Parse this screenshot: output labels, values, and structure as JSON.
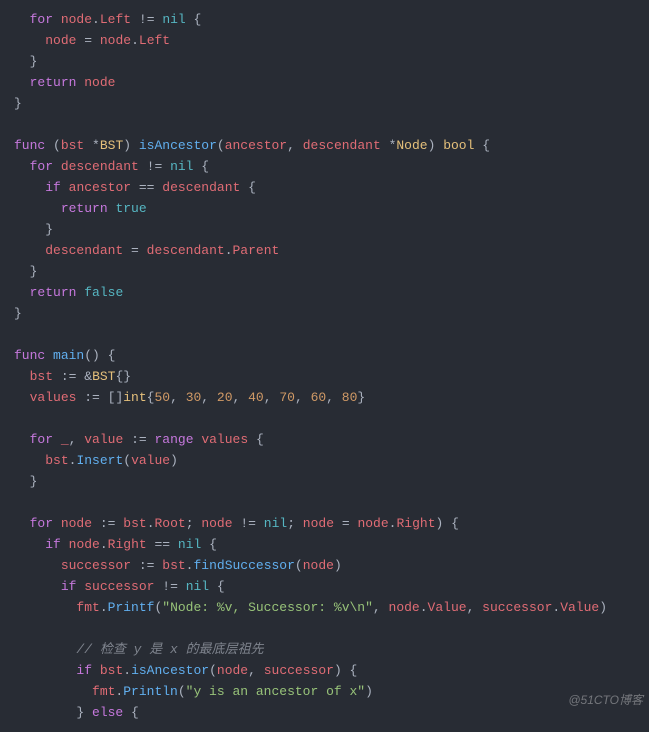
{
  "watermark": "@51CTO博客",
  "code": {
    "lines": [
      [
        [
          "pn",
          "  "
        ],
        [
          "kw",
          "for"
        ],
        [
          "pn",
          " "
        ],
        [
          "id",
          "node"
        ],
        [
          "pn",
          "."
        ],
        [
          "id",
          "Left"
        ],
        [
          "pn",
          " "
        ],
        [
          "op",
          "!="
        ],
        [
          "pn",
          " "
        ],
        [
          "lit",
          "nil"
        ],
        [
          "pn",
          " {"
        ]
      ],
      [
        [
          "pn",
          "    "
        ],
        [
          "id",
          "node"
        ],
        [
          "pn",
          " "
        ],
        [
          "op",
          "="
        ],
        [
          "pn",
          " "
        ],
        [
          "id",
          "node"
        ],
        [
          "pn",
          "."
        ],
        [
          "id",
          "Left"
        ]
      ],
      [
        [
          "pn",
          "  }"
        ]
      ],
      [
        [
          "pn",
          "  "
        ],
        [
          "kw",
          "return"
        ],
        [
          "pn",
          " "
        ],
        [
          "id",
          "node"
        ]
      ],
      [
        [
          "pn",
          "}"
        ]
      ],
      [
        [
          "pn",
          ""
        ]
      ],
      [
        [
          "kw",
          "func"
        ],
        [
          "pn",
          " ("
        ],
        [
          "id",
          "bst"
        ],
        [
          "pn",
          " "
        ],
        [
          "op",
          "*"
        ],
        [
          "typ",
          "BST"
        ],
        [
          "pn",
          ") "
        ],
        [
          "fn",
          "isAncestor"
        ],
        [
          "pn",
          "("
        ],
        [
          "id",
          "ancestor"
        ],
        [
          "pn",
          ", "
        ],
        [
          "id",
          "descendant"
        ],
        [
          "pn",
          " "
        ],
        [
          "op",
          "*"
        ],
        [
          "typ",
          "Node"
        ],
        [
          "pn",
          ") "
        ],
        [
          "typ",
          "bool"
        ],
        [
          "pn",
          " {"
        ]
      ],
      [
        [
          "pn",
          "  "
        ],
        [
          "kw",
          "for"
        ],
        [
          "pn",
          " "
        ],
        [
          "id",
          "descendant"
        ],
        [
          "pn",
          " "
        ],
        [
          "op",
          "!="
        ],
        [
          "pn",
          " "
        ],
        [
          "lit",
          "nil"
        ],
        [
          "pn",
          " {"
        ]
      ],
      [
        [
          "pn",
          "    "
        ],
        [
          "kw",
          "if"
        ],
        [
          "pn",
          " "
        ],
        [
          "id",
          "ancestor"
        ],
        [
          "pn",
          " "
        ],
        [
          "op",
          "=="
        ],
        [
          "pn",
          " "
        ],
        [
          "id",
          "descendant"
        ],
        [
          "pn",
          " {"
        ]
      ],
      [
        [
          "pn",
          "      "
        ],
        [
          "kw",
          "return"
        ],
        [
          "pn",
          " "
        ],
        [
          "lit",
          "true"
        ]
      ],
      [
        [
          "pn",
          "    }"
        ]
      ],
      [
        [
          "pn",
          "    "
        ],
        [
          "id",
          "descendant"
        ],
        [
          "pn",
          " "
        ],
        [
          "op",
          "="
        ],
        [
          "pn",
          " "
        ],
        [
          "id",
          "descendant"
        ],
        [
          "pn",
          "."
        ],
        [
          "id",
          "Parent"
        ]
      ],
      [
        [
          "pn",
          "  }"
        ]
      ],
      [
        [
          "pn",
          "  "
        ],
        [
          "kw",
          "return"
        ],
        [
          "pn",
          " "
        ],
        [
          "lit",
          "false"
        ]
      ],
      [
        [
          "pn",
          "}"
        ]
      ],
      [
        [
          "pn",
          ""
        ]
      ],
      [
        [
          "kw",
          "func"
        ],
        [
          "pn",
          " "
        ],
        [
          "fn",
          "main"
        ],
        [
          "pn",
          "() {"
        ]
      ],
      [
        [
          "pn",
          "  "
        ],
        [
          "id",
          "bst"
        ],
        [
          "pn",
          " "
        ],
        [
          "op",
          ":="
        ],
        [
          "pn",
          " "
        ],
        [
          "op",
          "&"
        ],
        [
          "typ",
          "BST"
        ],
        [
          "pn",
          "{}"
        ]
      ],
      [
        [
          "pn",
          "  "
        ],
        [
          "id",
          "values"
        ],
        [
          "pn",
          " "
        ],
        [
          "op",
          ":="
        ],
        [
          "pn",
          " []"
        ],
        [
          "typ",
          "int"
        ],
        [
          "pn",
          "{"
        ],
        [
          "num",
          "50"
        ],
        [
          "pn",
          ", "
        ],
        [
          "num",
          "30"
        ],
        [
          "pn",
          ", "
        ],
        [
          "num",
          "20"
        ],
        [
          "pn",
          ", "
        ],
        [
          "num",
          "40"
        ],
        [
          "pn",
          ", "
        ],
        [
          "num",
          "70"
        ],
        [
          "pn",
          ", "
        ],
        [
          "num",
          "60"
        ],
        [
          "pn",
          ", "
        ],
        [
          "num",
          "80"
        ],
        [
          "pn",
          "}"
        ]
      ],
      [
        [
          "pn",
          ""
        ]
      ],
      [
        [
          "pn",
          "  "
        ],
        [
          "kw",
          "for"
        ],
        [
          "pn",
          " "
        ],
        [
          "id",
          "_"
        ],
        [
          "pn",
          ", "
        ],
        [
          "id",
          "value"
        ],
        [
          "pn",
          " "
        ],
        [
          "op",
          ":="
        ],
        [
          "pn",
          " "
        ],
        [
          "kw",
          "range"
        ],
        [
          "pn",
          " "
        ],
        [
          "id",
          "values"
        ],
        [
          "pn",
          " {"
        ]
      ],
      [
        [
          "pn",
          "    "
        ],
        [
          "id",
          "bst"
        ],
        [
          "pn",
          "."
        ],
        [
          "fn",
          "Insert"
        ],
        [
          "pn",
          "("
        ],
        [
          "id",
          "value"
        ],
        [
          "pn",
          ")"
        ]
      ],
      [
        [
          "pn",
          "  }"
        ]
      ],
      [
        [
          "pn",
          ""
        ]
      ],
      [
        [
          "pn",
          "  "
        ],
        [
          "kw",
          "for"
        ],
        [
          "pn",
          " "
        ],
        [
          "id",
          "node"
        ],
        [
          "pn",
          " "
        ],
        [
          "op",
          ":="
        ],
        [
          "pn",
          " "
        ],
        [
          "id",
          "bst"
        ],
        [
          "pn",
          "."
        ],
        [
          "id",
          "Root"
        ],
        [
          "pn",
          "; "
        ],
        [
          "id",
          "node"
        ],
        [
          "pn",
          " "
        ],
        [
          "op",
          "!="
        ],
        [
          "pn",
          " "
        ],
        [
          "lit",
          "nil"
        ],
        [
          "pn",
          "; "
        ],
        [
          "id",
          "node"
        ],
        [
          "pn",
          " "
        ],
        [
          "op",
          "="
        ],
        [
          "pn",
          " "
        ],
        [
          "id",
          "node"
        ],
        [
          "pn",
          "."
        ],
        [
          "id",
          "Right"
        ],
        [
          "pn",
          ") {"
        ]
      ],
      [
        [
          "pn",
          "    "
        ],
        [
          "kw",
          "if"
        ],
        [
          "pn",
          " "
        ],
        [
          "id",
          "node"
        ],
        [
          "pn",
          "."
        ],
        [
          "id",
          "Right"
        ],
        [
          "pn",
          " "
        ],
        [
          "op",
          "=="
        ],
        [
          "pn",
          " "
        ],
        [
          "lit",
          "nil"
        ],
        [
          "pn",
          " {"
        ]
      ],
      [
        [
          "pn",
          "      "
        ],
        [
          "id",
          "successor"
        ],
        [
          "pn",
          " "
        ],
        [
          "op",
          ":="
        ],
        [
          "pn",
          " "
        ],
        [
          "id",
          "bst"
        ],
        [
          "pn",
          "."
        ],
        [
          "fn",
          "findSuccessor"
        ],
        [
          "pn",
          "("
        ],
        [
          "id",
          "node"
        ],
        [
          "pn",
          ")"
        ]
      ],
      [
        [
          "pn",
          "      "
        ],
        [
          "kw",
          "if"
        ],
        [
          "pn",
          " "
        ],
        [
          "id",
          "successor"
        ],
        [
          "pn",
          " "
        ],
        [
          "op",
          "!="
        ],
        [
          "pn",
          " "
        ],
        [
          "lit",
          "nil"
        ],
        [
          "pn",
          " {"
        ]
      ],
      [
        [
          "pn",
          "        "
        ],
        [
          "id",
          "fmt"
        ],
        [
          "pn",
          "."
        ],
        [
          "fn",
          "Printf"
        ],
        [
          "pn",
          "("
        ],
        [
          "str",
          "\"Node: %v, Successor: %v\\n\""
        ],
        [
          "pn",
          ", "
        ],
        [
          "id",
          "node"
        ],
        [
          "pn",
          "."
        ],
        [
          "id",
          "Value"
        ],
        [
          "pn",
          ", "
        ],
        [
          "id",
          "successor"
        ],
        [
          "pn",
          "."
        ],
        [
          "id",
          "Value"
        ],
        [
          "pn",
          ")"
        ]
      ],
      [
        [
          "pn",
          ""
        ]
      ],
      [
        [
          "pn",
          "        "
        ],
        [
          "com",
          "// 检查 y 是 x 的最底层祖先"
        ]
      ],
      [
        [
          "pn",
          "        "
        ],
        [
          "kw",
          "if"
        ],
        [
          "pn",
          " "
        ],
        [
          "id",
          "bst"
        ],
        [
          "pn",
          "."
        ],
        [
          "fn",
          "isAncestor"
        ],
        [
          "pn",
          "("
        ],
        [
          "id",
          "node"
        ],
        [
          "pn",
          ", "
        ],
        [
          "id",
          "successor"
        ],
        [
          "pn",
          ") {"
        ]
      ],
      [
        [
          "pn",
          "          "
        ],
        [
          "id",
          "fmt"
        ],
        [
          "pn",
          "."
        ],
        [
          "fn",
          "Println"
        ],
        [
          "pn",
          "("
        ],
        [
          "str",
          "\"y is an ancestor of x\""
        ],
        [
          "pn",
          ")"
        ]
      ],
      [
        [
          "pn",
          "        } "
        ],
        [
          "kw",
          "else"
        ],
        [
          "pn",
          " {"
        ]
      ]
    ]
  }
}
